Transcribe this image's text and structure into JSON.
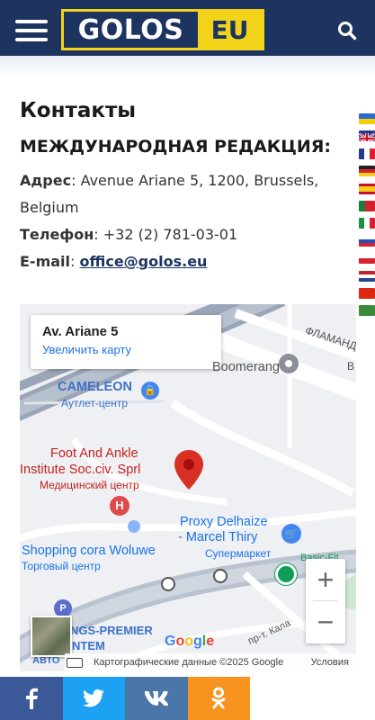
{
  "header": {
    "logo_main": "GOLOS",
    "logo_suffix": "EU",
    "colors": {
      "bar": "#1d3461",
      "accent": "#f3d21a"
    },
    "menu_icon": "hamburger-menu-icon",
    "search_icon": "search-icon"
  },
  "contacts": {
    "title": "Контакты",
    "subtitle": "МЕЖДУНАРОДНАЯ РЕДАКЦИЯ:",
    "address_label": "Адрес",
    "address_value": ": Avenue Ariane 5, 1200, Brussels, Belgium",
    "phone_label": "Телефон",
    "phone_value": ": +32 (2) 781-03-01",
    "email_label": "E-mail",
    "email_sep": ": ",
    "email_value": "office@golos.eu"
  },
  "languages": [
    "uk",
    "en",
    "fr",
    "de",
    "es",
    "pt",
    "it",
    "ru",
    "pl",
    "nl",
    "zh",
    "ar"
  ],
  "map": {
    "card_title": "Av. Ariane 5",
    "card_link": "Увеличить карту",
    "pois": {
      "boomerang": "Boomerang",
      "cameleon": "CAMELEON",
      "cameleon_sub": "Аутлет-центр",
      "foot_ankle_1": "Foot And Ankle",
      "foot_ankle_2": "Institute Soc.civ. Sprl",
      "foot_ankle_sub": "Медицинский центр",
      "proxy_1": "Proxy Delhaize",
      "proxy_2": "- Marcel Thiry",
      "proxy_sub": "Супермаркет",
      "cora": "Shopping cora Woluwe",
      "cora_sub": "Торговый центр",
      "flamand": "ФЛАМАНД",
      "kings_1": "NGS-PREMIER",
      "kings_2": "NTEM",
      "avto": "АВТО",
      "street_kala": "пр-т. Кала",
      "letter_v": "В",
      "basic_fit": "Basic-Fit"
    },
    "google": "Google",
    "attribution": "Картографические данные ©2025 Google",
    "terms": "Условия",
    "zoom_in": "+",
    "zoom_out": "−"
  },
  "share": [
    {
      "network": "facebook",
      "icon": "facebook-icon",
      "color": "#3b5998"
    },
    {
      "network": "twitter",
      "icon": "twitter-icon",
      "color": "#1da1f2"
    },
    {
      "network": "vk",
      "icon": "vk-icon",
      "color": "#4a76a8"
    },
    {
      "network": "odnoklassniki",
      "icon": "odnoklassniki-icon",
      "color": "#f7931e"
    }
  ]
}
